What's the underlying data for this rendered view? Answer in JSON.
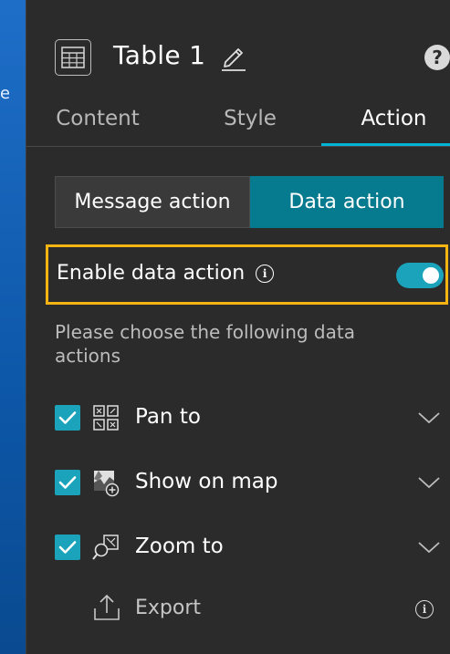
{
  "background": {
    "fragment": "e"
  },
  "header": {
    "title": "Table 1",
    "icons": {
      "widget": "table-grid-icon",
      "edit": "pencil-icon",
      "help": "help-icon"
    },
    "help_glyph": "?"
  },
  "tabs": [
    {
      "label": "Content",
      "active": false
    },
    {
      "label": "Style",
      "active": false
    },
    {
      "label": "Action",
      "active": true
    }
  ],
  "segmented": {
    "message_action": "Message action",
    "data_action": "Data action",
    "selected": "Data action"
  },
  "enable": {
    "label": "Enable data action",
    "enabled": true,
    "info_glyph": "i"
  },
  "description": "Please choose the following data actions",
  "actions": [
    {
      "label": "Pan to",
      "checked": true,
      "icon": "pan-to-icon"
    },
    {
      "label": "Show on map",
      "checked": true,
      "icon": "show-on-map-icon"
    },
    {
      "label": "Zoom to",
      "checked": true,
      "icon": "zoom-to-icon"
    }
  ],
  "export": {
    "label": "Export",
    "icon": "export-icon",
    "info_glyph": "i"
  },
  "colors": {
    "panel_bg": "#2b2b2b",
    "accent": "#1aa3bb",
    "active_segment": "#067a8e",
    "highlight_border": "#f3b414",
    "tab_underline": "#00b4d8"
  }
}
